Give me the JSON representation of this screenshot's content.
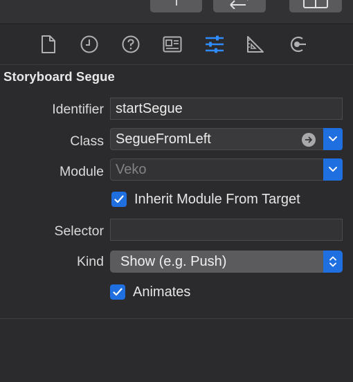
{
  "inspector_tabs": [
    {
      "icon": "file-icon"
    },
    {
      "icon": "history-icon"
    },
    {
      "icon": "help-icon"
    },
    {
      "icon": "identity-icon"
    },
    {
      "icon": "attributes-icon",
      "active": true
    },
    {
      "icon": "size-icon"
    },
    {
      "icon": "connections-icon"
    }
  ],
  "section": {
    "title": "Storyboard Segue"
  },
  "form": {
    "identifier": {
      "label": "Identifier",
      "value": "startSegue"
    },
    "class": {
      "label": "Class",
      "value": "SegueFromLeft"
    },
    "module": {
      "label": "Module",
      "placeholder": "Veko"
    },
    "inherit": {
      "label": "Inherit Module From Target",
      "checked": true
    },
    "selector": {
      "label": "Selector",
      "value": ""
    },
    "kind": {
      "label": "Kind",
      "value": "Show (e.g. Push)"
    },
    "animates": {
      "label": "Animates",
      "checked": true
    }
  },
  "colors": {
    "accent": "#1f6fe0",
    "background": "#2b2b2d"
  }
}
